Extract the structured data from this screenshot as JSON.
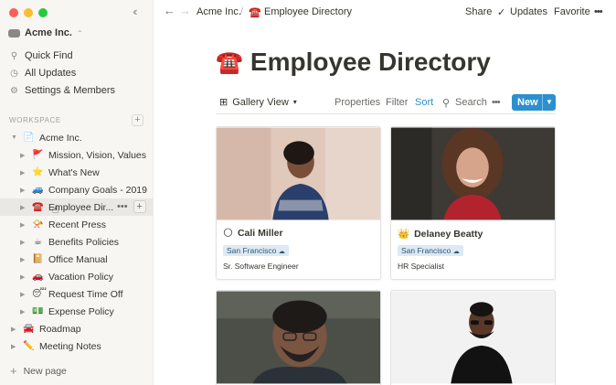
{
  "sidebar": {
    "workspace_name": "Acme Inc.",
    "quick_find": "Quick Find",
    "all_updates": "All Updates",
    "settings": "Settings & Members",
    "section_label": "WORKSPACE",
    "tree": [
      {
        "emoji": "📄",
        "label": "Acme Inc."
      },
      {
        "emoji": "🚩",
        "label": "Mission, Vision, Values"
      },
      {
        "emoji": "⭐",
        "label": "What's New"
      },
      {
        "emoji": "🚙",
        "label": "Company Goals - 2019"
      },
      {
        "emoji": "☎️",
        "label": "Employee Dir..."
      },
      {
        "emoji": "📯",
        "label": "Recent Press"
      },
      {
        "emoji": "☕",
        "label": "Benefits Policies"
      },
      {
        "emoji": "📔",
        "label": "Office Manual"
      },
      {
        "emoji": "🚗",
        "label": "Vacation Policy"
      },
      {
        "emoji": "😴",
        "label": "Request Time Off"
      },
      {
        "emoji": "💵",
        "label": "Expense Policy"
      },
      {
        "emoji": "🚘",
        "label": "Roadmap"
      },
      {
        "emoji": "✏️",
        "label": "Meeting Notes"
      }
    ],
    "new_page": "New page"
  },
  "topbar": {
    "crumb_workspace": "Acme Inc.",
    "crumb_sep": "/",
    "crumb_page_emoji": "☎️",
    "crumb_page": "Employee Directory",
    "share": "Share",
    "updates": "Updates",
    "favorite": "Favorite",
    "more": "•••"
  },
  "page": {
    "emoji": "☎️",
    "title": "Employee Directory"
  },
  "viewbar": {
    "view_name": "Gallery View",
    "properties": "Properties",
    "filter": "Filter",
    "sort": "Sort",
    "search": "Search",
    "more": "•••",
    "new": "New"
  },
  "cards": [
    {
      "emoji": "🌕",
      "name": "Cali Miller",
      "location": "San Francisco",
      "role": "Sr. Software Engineer"
    },
    {
      "emoji": "👑",
      "name": "Delaney Beatty",
      "location": "San Francisco",
      "role": "HR Specialist"
    },
    {
      "emoji": "",
      "name": "",
      "location": "",
      "role": ""
    },
    {
      "emoji": "",
      "name": "",
      "location": "",
      "role": ""
    }
  ],
  "colors": {
    "sidebar_bg": "#f7f6f3",
    "accent_blue": "#2e8fce",
    "tag_bg": "#dde9f3"
  }
}
